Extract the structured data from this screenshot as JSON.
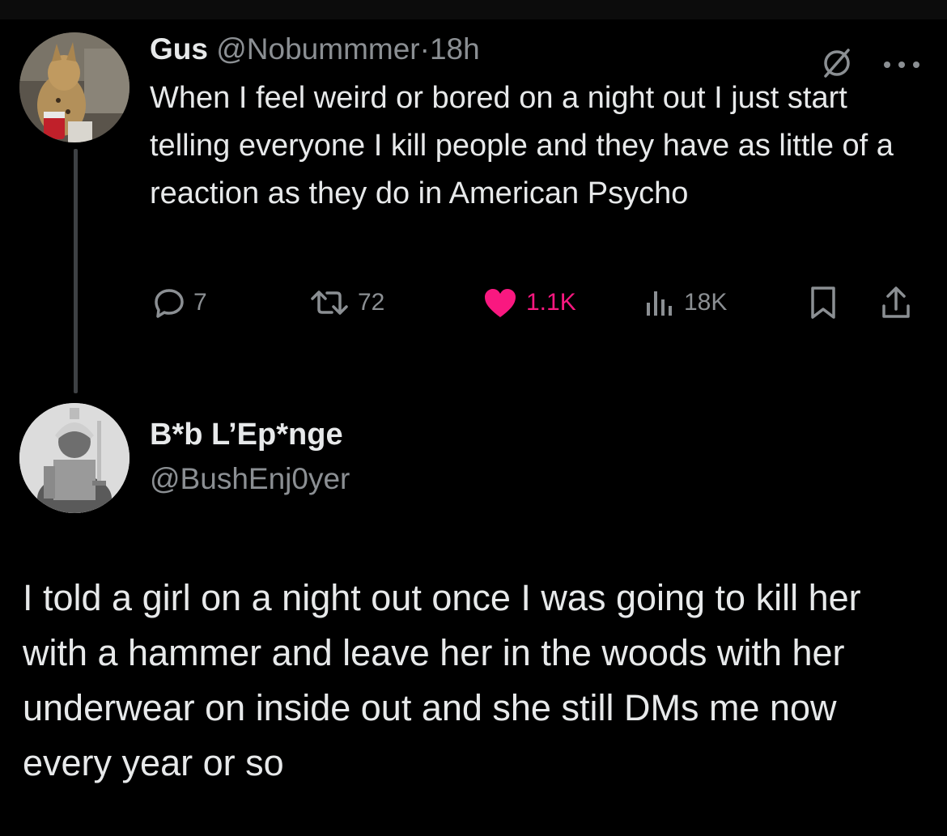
{
  "parent_tweet": {
    "author_name": "Gus",
    "author_handle": "@Nobummmer",
    "separator": "·",
    "time": "18h",
    "text": "When I feel weird or bored on a night out I just start telling everyone I kill people and they have as little of a reaction as they do in American Psycho",
    "replies": "7",
    "retweets": "72",
    "likes": "1.1K",
    "views": "18K",
    "liked": true,
    "icons": [
      "no-symbol-icon",
      "more-icon",
      "reply-icon",
      "retweet-icon",
      "heart-icon",
      "views-icon",
      "bookmark-icon",
      "share-icon"
    ]
  },
  "main_tweet": {
    "author_name": "B*b L’Ep*nge",
    "author_handle": "@BushEnj0yer",
    "text": "I told a girl on a night out once I was going to kill her with a hammer and leave her in the woods with her underwear on inside out and she still DMs me now every year or so"
  },
  "colors": {
    "background": "#000000",
    "text": "#e7e9ea",
    "secondary": "#8b8f93",
    "like": "#f91880",
    "thread_line": "#3e4144"
  }
}
